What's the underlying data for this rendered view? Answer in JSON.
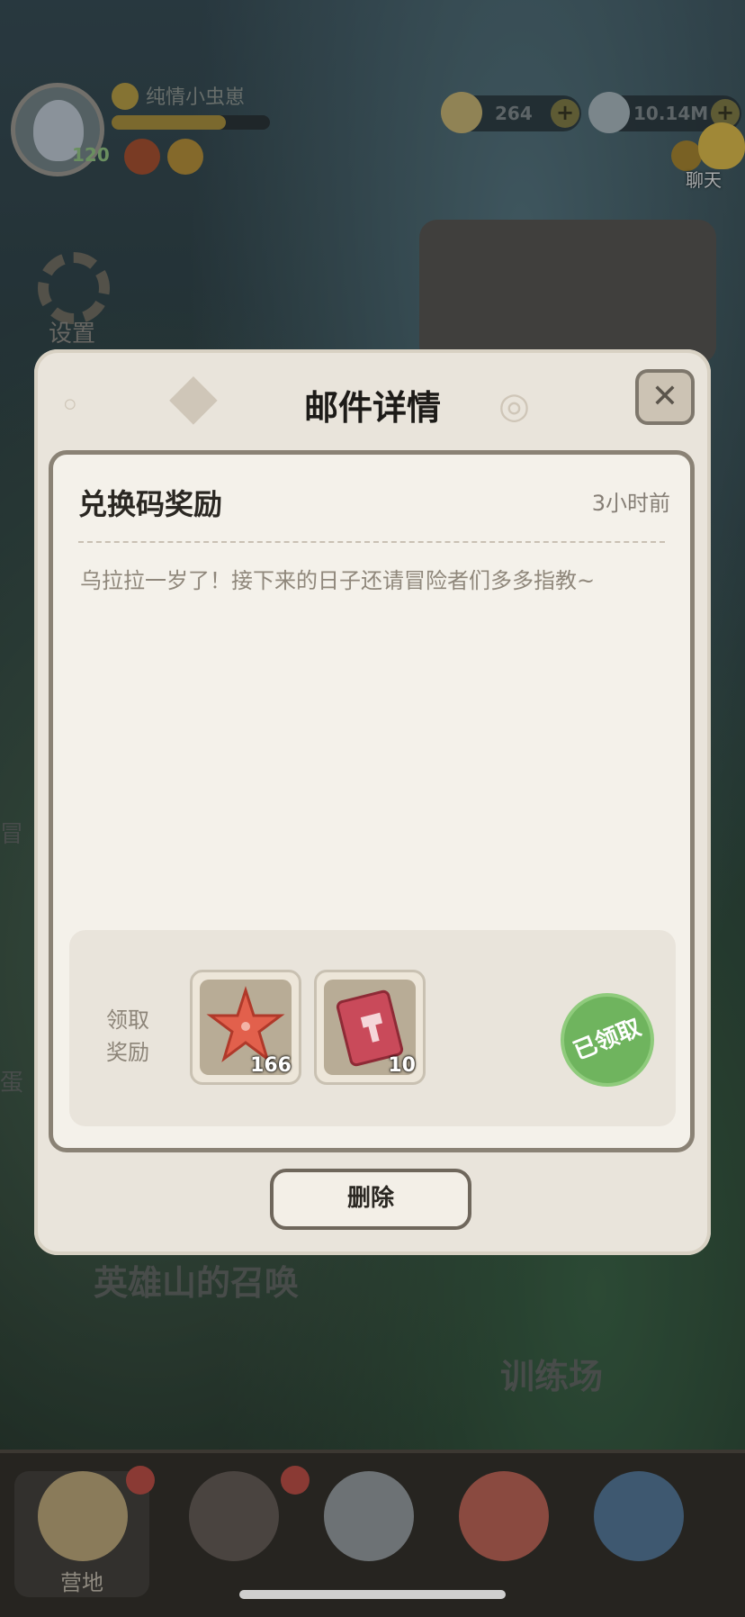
{
  "header": {
    "player_name": "纯情小虫崽",
    "level": "120",
    "exp_fraction": 0.72,
    "resources": [
      {
        "name": "gold-icon",
        "value": "264"
      },
      {
        "name": "stone-icon",
        "value": "10.14M"
      }
    ],
    "chat_label": "聊天",
    "settings_label": "设置"
  },
  "background_text": {
    "side_1": "冒",
    "side_2": "蛋",
    "banner_1": "英雄山的召唤",
    "banner_2": "训练场"
  },
  "modal": {
    "title": "邮件详情",
    "close_icon": "close-x",
    "mail": {
      "subject": "兑换码奖励",
      "time": "3小时前",
      "body": "乌拉拉一岁了！接下来的日子还请冒险者们多多指教~"
    },
    "rewards": {
      "label": "领取\n奖励",
      "items": [
        {
          "icon": "starfish-icon",
          "count": "166"
        },
        {
          "icon": "ticket-icon",
          "count": "10"
        }
      ],
      "status": "已领取"
    },
    "delete_label": "删除"
  },
  "bottom_nav": {
    "items": [
      {
        "label": "营地",
        "selected": true,
        "alert": true
      },
      {
        "label": "",
        "alert": true
      },
      {
        "label": ""
      },
      {
        "label": ""
      },
      {
        "label": ""
      }
    ]
  },
  "colors": {
    "panel": "#e9e4db",
    "claimed_green": "#6fb45e",
    "text_dark": "#1d1b18"
  }
}
